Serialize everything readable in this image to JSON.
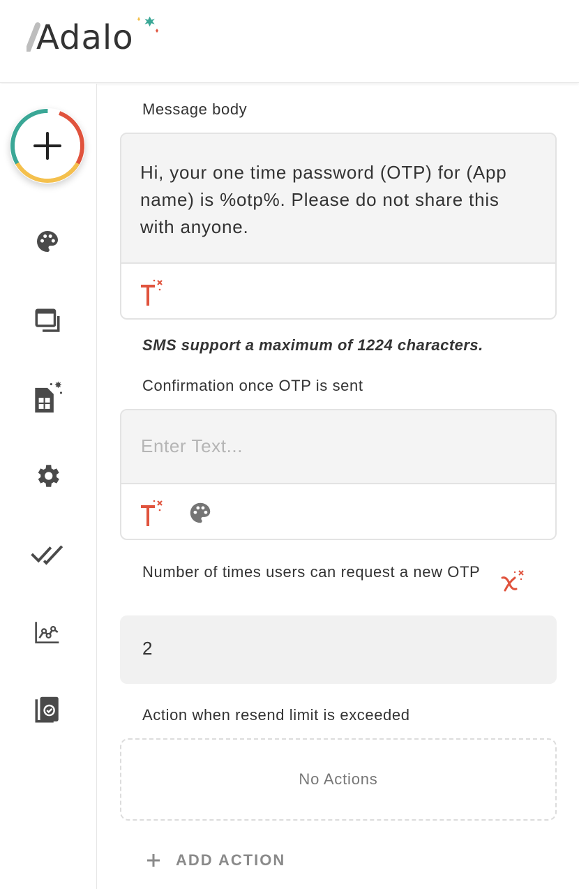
{
  "app": {
    "logo_text": "Adalo"
  },
  "sidebar": {
    "add_button_icon": "plus-icon",
    "items": [
      {
        "name": "palette-icon"
      },
      {
        "name": "screens-icon"
      },
      {
        "name": "database-icon"
      },
      {
        "name": "settings-icon"
      },
      {
        "name": "checkmarks-icon"
      },
      {
        "name": "analytics-icon"
      },
      {
        "name": "publish-icon"
      }
    ]
  },
  "form": {
    "message_body_label": "Message body",
    "message_body_value": "Hi, your one time password (OTP) for (App name) is %otp%. Please do not share this with anyone.",
    "sms_note": "SMS support a maximum of 1224 characters.",
    "confirmation_label": "Confirmation once OTP is sent",
    "confirmation_placeholder": "Enter Text...",
    "resend_label": "Number of times users can request a new OTP",
    "resend_value": "2",
    "exceeded_label": "Action when resend limit is exceeded",
    "no_actions_text": "No Actions",
    "add_action_label": "ADD ACTION"
  },
  "colors": {
    "accent_red": "#e0533d",
    "teal": "#3aa796",
    "yellow": "#f4c04d",
    "icon_gray": "#4a4a4a"
  }
}
